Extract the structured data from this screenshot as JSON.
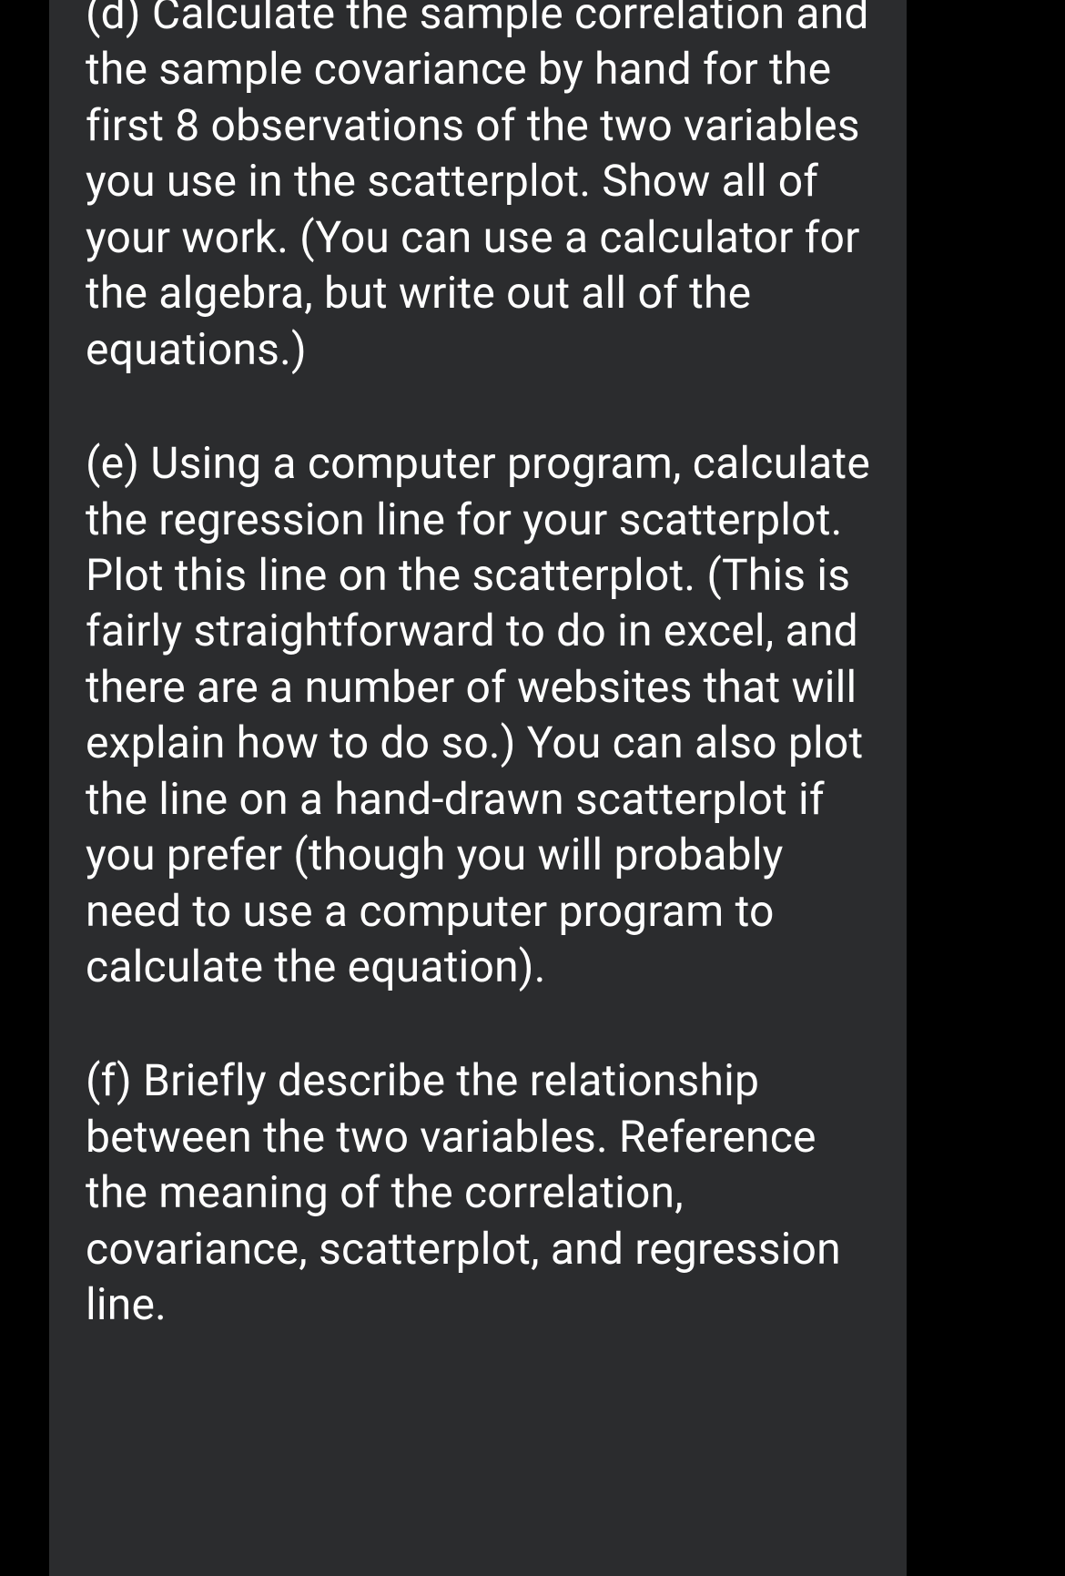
{
  "questions": {
    "d": "(d) Calculate the sample correlation and the sample covariance by hand for the first 8 observations of the two variables you use in the scatterplot. Show all of your work. (You can use a calculator for the algebra, but write out all of the equations.)",
    "e": "(e) Using a computer program, calculate the regression line for your scatterplot. Plot this line on the scatterplot. (This is fairly straightforward to do in excel, and there are a number of websites that will explain how to do so.) You can also plot the line on a hand-drawn scatterplot if you prefer (though you will probably need to use a computer program to calculate the equation).",
    "f": "(f) Briefly describe the relationship between the two variables. Reference the meaning of the correlation, covariance, scatterplot, and regression line."
  }
}
